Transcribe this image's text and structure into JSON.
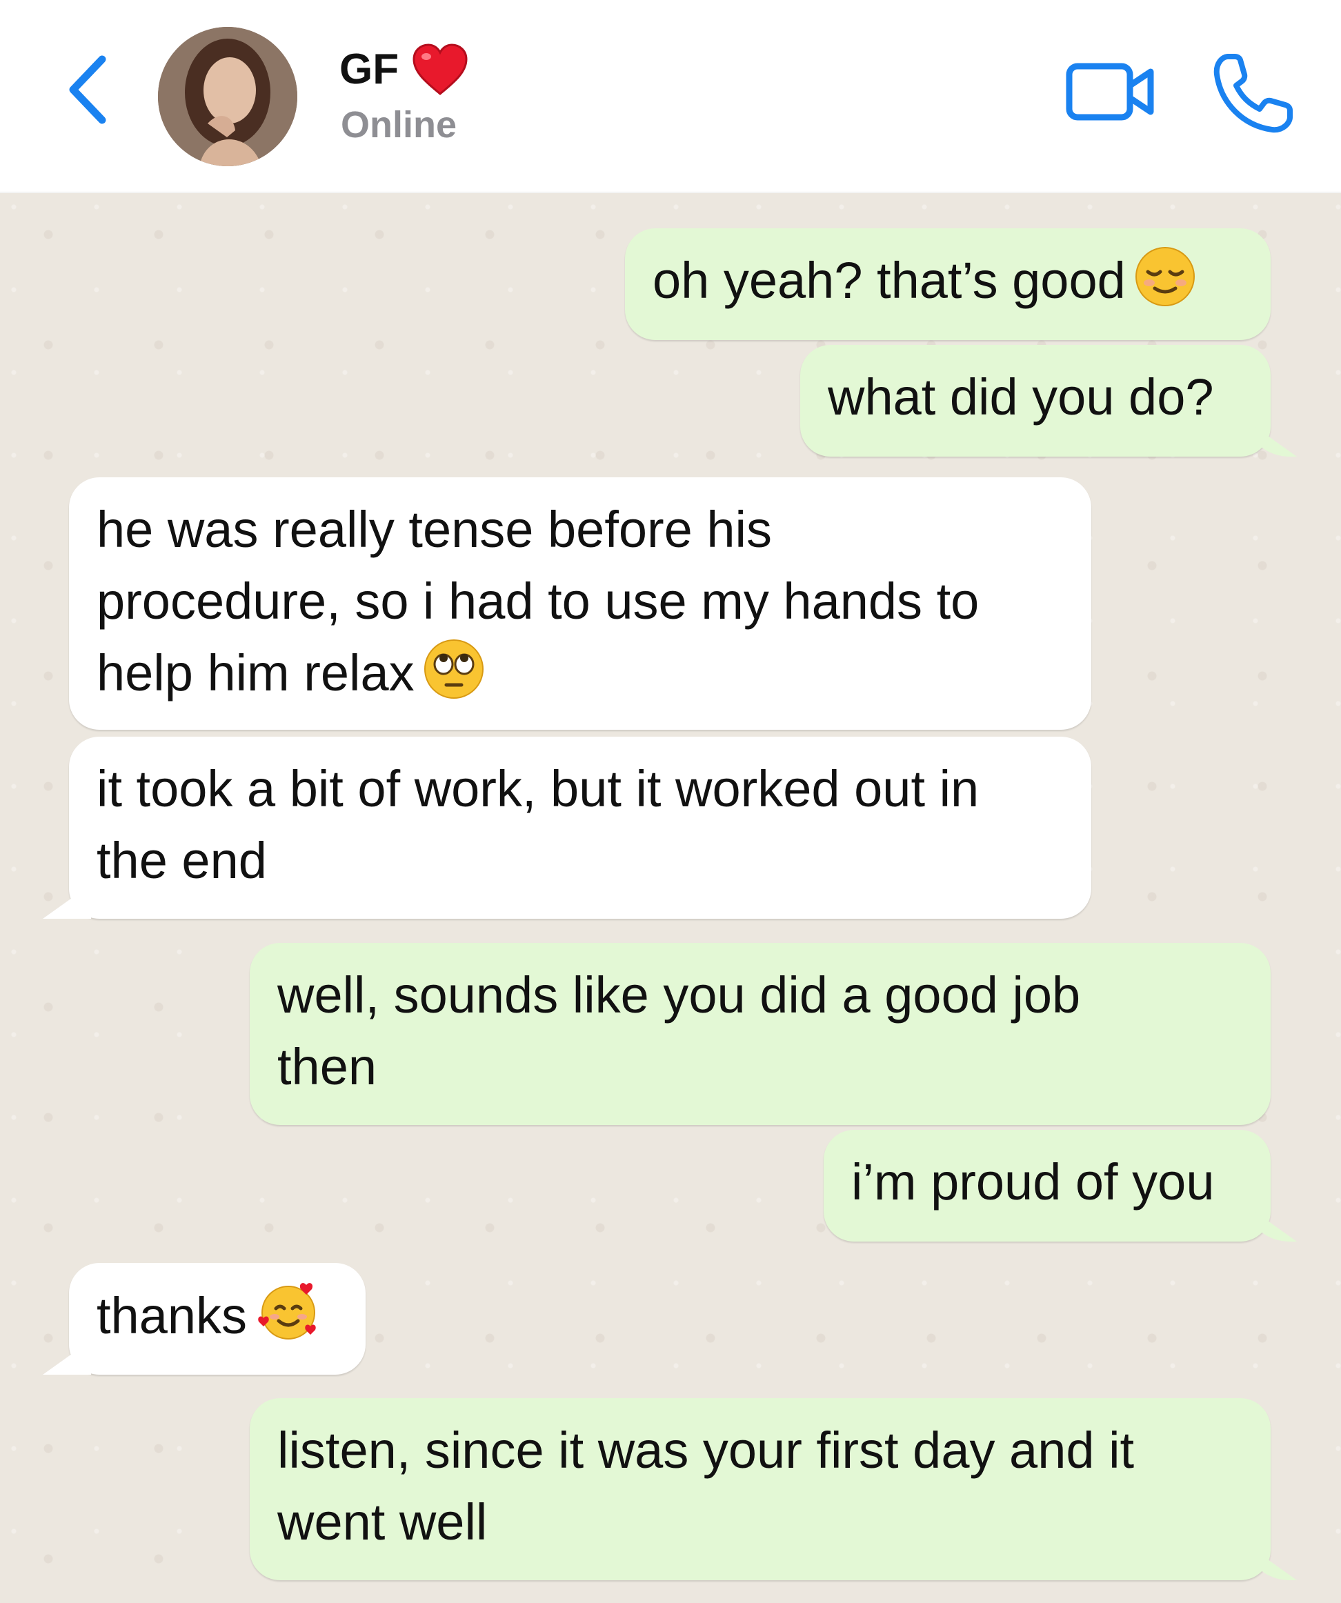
{
  "header": {
    "contact_name": "GF",
    "status": "Online",
    "accent_color": "#1a82f0",
    "icons": [
      "back-chevron-icon",
      "red-heart-icon",
      "video-camera-icon",
      "phone-icon"
    ]
  },
  "messages": [
    {
      "direction": "outgoing",
      "text": "oh yeah? that’s good",
      "emoji": "relieved-face"
    },
    {
      "direction": "outgoing",
      "text": "what did you do?"
    },
    {
      "direction": "incoming",
      "line1": "he was really tense before his",
      "line2": "procedure, so i had to use my hands to",
      "line3": "help him relax",
      "emoji": "rolling-eyes-face"
    },
    {
      "direction": "incoming",
      "line1": "it took a bit of work, but it worked out in",
      "line2": "the end"
    },
    {
      "direction": "outgoing",
      "line1": "well, sounds like you did a good job",
      "line2": "then"
    },
    {
      "direction": "outgoing",
      "text": "i’m proud of you"
    },
    {
      "direction": "incoming",
      "text": "thanks",
      "emoji": "smiling-face-with-hearts"
    },
    {
      "direction": "outgoing",
      "line1": "listen, since it was your first day and it",
      "line2": "went well"
    }
  ],
  "colors": {
    "outgoing_bubble": "#e3f8d5",
    "incoming_bubble": "#ffffff",
    "chat_background": "#ece7df"
  }
}
